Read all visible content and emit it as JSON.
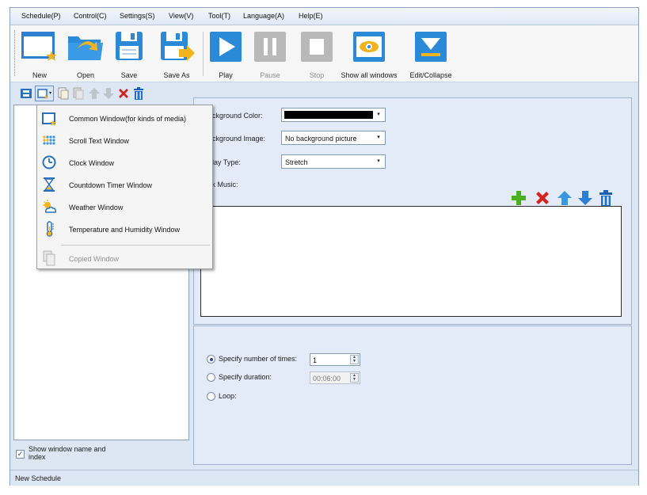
{
  "menubar": {
    "items": [
      "Schedule(P)",
      "Control(C)",
      "Settings(S)",
      "View(V)",
      "Tool(T)",
      "Language(A)",
      "Help(E)"
    ]
  },
  "toolbar": {
    "new": "New",
    "open": "Open",
    "save": "Save",
    "save_as": "Save As",
    "play": "Play",
    "pause": "Pause",
    "stop": "Stop",
    "show_all": "Show all windows",
    "edit_collapse": "Edit/Collapse"
  },
  "window_menu": {
    "items": [
      {
        "label": "Common Window(for kinds of media)",
        "icon": "common-window-icon"
      },
      {
        "label": "Scroll Text Window",
        "icon": "scroll-text-icon"
      },
      {
        "label": "Clock Window",
        "icon": "clock-icon"
      },
      {
        "label": "Countdown Timer Window",
        "icon": "hourglass-icon"
      },
      {
        "label": "Weather Window",
        "icon": "weather-icon"
      },
      {
        "label": "Temperature and Humidity Window",
        "icon": "thermometer-icon"
      }
    ],
    "disabled_item": {
      "label": "Copied Window",
      "icon": "copied-window-icon"
    }
  },
  "settings": {
    "bg_color_label": "ackground Color:",
    "bg_color_value": "#000000",
    "bg_image_label": "ackground Image:",
    "bg_image_value": "No background picture",
    "display_type_label": "play Type:",
    "display_type_value": "Stretch",
    "music_label": "ck Music:"
  },
  "playback": {
    "times_label": "Specify number of times:",
    "times_value": "1",
    "duration_label": "Specify duration:",
    "duration_value": "00:06:00",
    "loop_label": "Loop:",
    "selected": "times"
  },
  "left_panel": {
    "show_name_label": "Show window name and index",
    "show_name_checked": true
  },
  "statusbar": {
    "text": "New Schedule"
  },
  "colors": {
    "accent_blue": "#2a8ad8",
    "add_green": "#49b01f",
    "delete_red": "#d3231c"
  }
}
